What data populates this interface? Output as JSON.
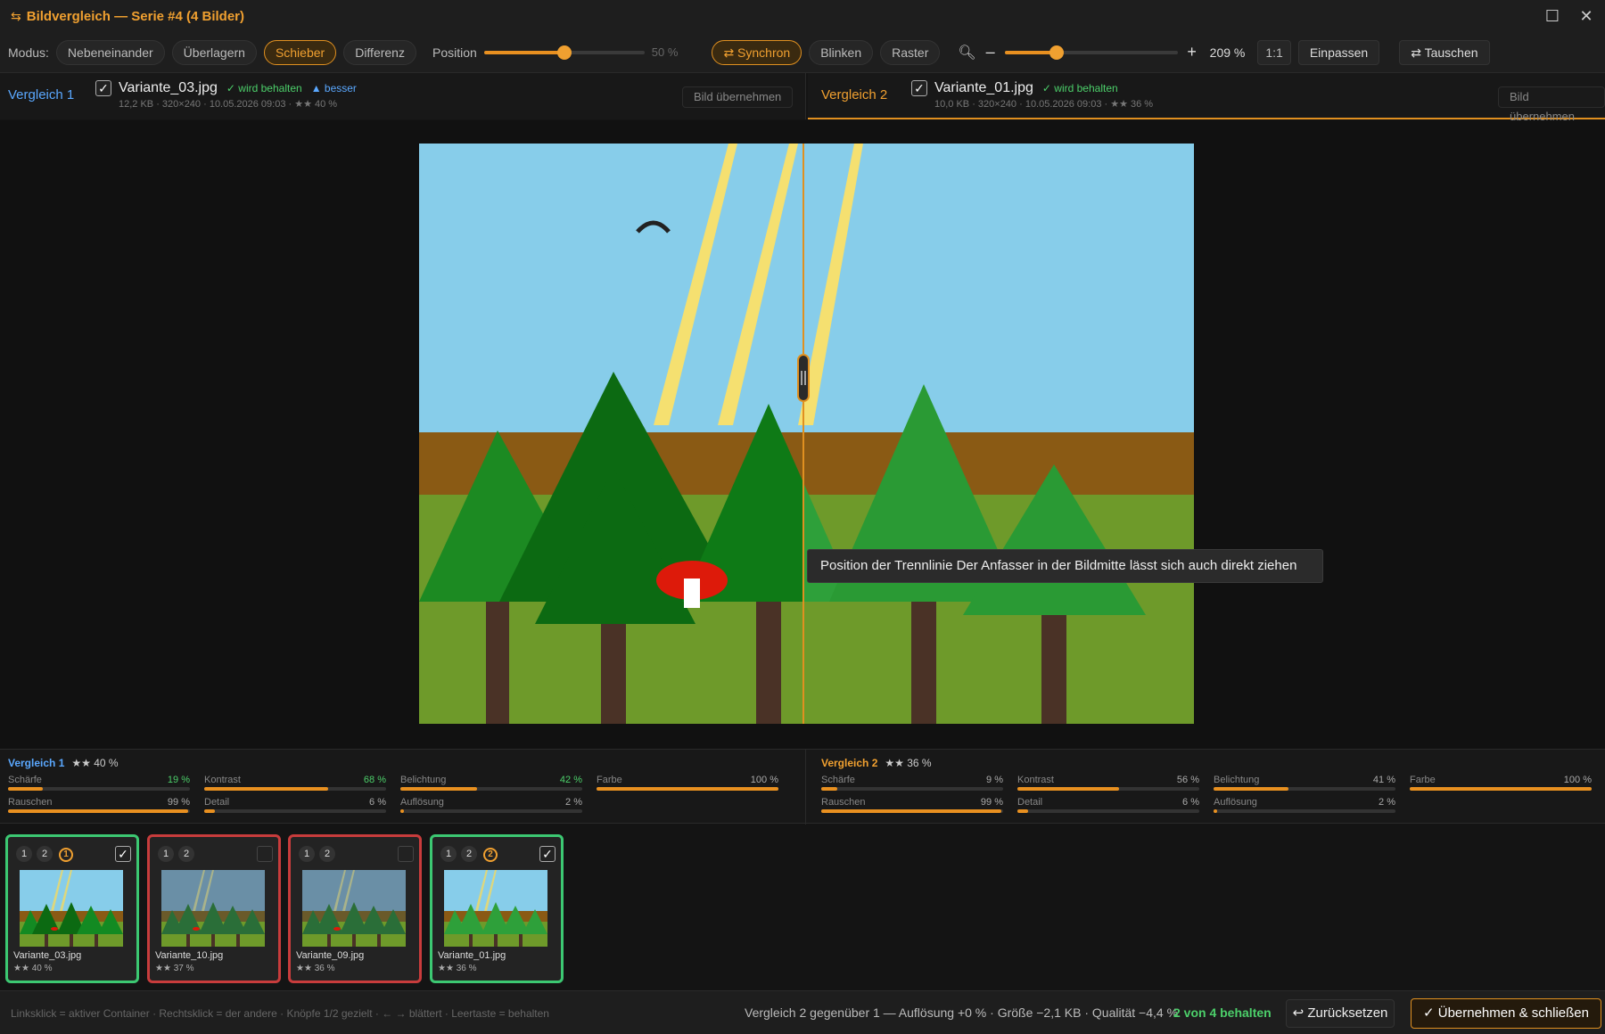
{
  "window": {
    "title": "Bildvergleich — Serie #4 (4 Bilder)"
  },
  "toolbar": {
    "mode_label": "Modus:",
    "modes": [
      "Nebeneinander",
      "Überlagern",
      "Schieber",
      "Differenz"
    ],
    "active_mode": "Schieber",
    "position_label": "Position",
    "position_value": "50 %",
    "position_fraction": 0.5,
    "sync_label": "⇄ Synchron",
    "blink_label": "Blinken",
    "grid_label": "Raster",
    "zoom_minus": "–",
    "zoom_plus": "+",
    "zoom_value": "209 %",
    "zoom_fraction": 0.3,
    "one_to_one": "1:1",
    "fit_label": "Einpassen",
    "swap_label": "⇄ Tauschen"
  },
  "compare1": {
    "tag": "Vergleich 1",
    "filename": "Variante_03.jpg",
    "keep_badge": "✓ wird behalten",
    "better_badge": "▲ besser",
    "meta": "12,2 KB · 320×240 · 10.05.2026 09:03 · ★★ 40 %",
    "take_label": "Bild übernehmen",
    "score": "★★ 40 %"
  },
  "compare2": {
    "tag": "Vergleich 2",
    "filename": "Variante_01.jpg",
    "keep_badge": "✓ wird behalten",
    "meta": "10,0 KB · 320×240 · 10.05.2026 09:03 · ★★ 36 %",
    "take_label": "Bild übernehmen",
    "score": "★★ 36 %"
  },
  "tooltip": "Position der Trennlinie Der Anfasser in der Bildmitte lässt sich auch direkt ziehen",
  "metrics1": [
    {
      "name": "Schärfe",
      "value": "19 %",
      "fraction": 0.19,
      "highlight": true
    },
    {
      "name": "Kontrast",
      "value": "68 %",
      "fraction": 0.68,
      "highlight": true
    },
    {
      "name": "Belichtung",
      "value": "42 %",
      "fraction": 0.42,
      "highlight": true
    },
    {
      "name": "Farbe",
      "value": "100 %",
      "fraction": 1.0,
      "highlight": false
    },
    {
      "name": "Rauschen",
      "value": "99 %",
      "fraction": 0.99,
      "highlight": false
    },
    {
      "name": "Detail",
      "value": "6 %",
      "fraction": 0.06,
      "highlight": false
    },
    {
      "name": "Auflösung",
      "value": "2 %",
      "fraction": 0.02,
      "highlight": false
    }
  ],
  "metrics2": [
    {
      "name": "Schärfe",
      "value": "9 %",
      "fraction": 0.09,
      "highlight": false
    },
    {
      "name": "Kontrast",
      "value": "56 %",
      "fraction": 0.56,
      "highlight": false
    },
    {
      "name": "Belichtung",
      "value": "41 %",
      "fraction": 0.41,
      "highlight": false
    },
    {
      "name": "Farbe",
      "value": "100 %",
      "fraction": 1.0,
      "highlight": false
    },
    {
      "name": "Rauschen",
      "value": "99 %",
      "fraction": 0.99,
      "highlight": false
    },
    {
      "name": "Detail",
      "value": "6 %",
      "fraction": 0.06,
      "highlight": false
    },
    {
      "name": "Auflösung",
      "value": "2 %",
      "fraction": 0.02,
      "highlight": false
    }
  ],
  "thumbnails": [
    {
      "name": "Variante_03.jpg",
      "stars": "★★ 40 %",
      "status": "keep",
      "checked": true,
      "badge": "1",
      "variant": "bright"
    },
    {
      "name": "Variante_10.jpg",
      "stars": "★★ 37 %",
      "status": "drop",
      "checked": false,
      "badge": "",
      "variant": "dim"
    },
    {
      "name": "Variante_09.jpg",
      "stars": "★★ 36 %",
      "status": "drop",
      "checked": false,
      "badge": "",
      "variant": "dim"
    },
    {
      "name": "Variante_01.jpg",
      "stars": "★★ 36 %",
      "status": "keep",
      "checked": true,
      "badge": "2",
      "variant": "light"
    }
  ],
  "thumb_buttons": [
    "1",
    "2"
  ],
  "statusbar": {
    "hint": "Linksklick = aktiver Container · Rechtsklick = der andere · Knöpfe 1/2 gezielt · ← → blättert · Leertaste = behalten",
    "summary": "Vergleich 2 gegenüber 1 — Auflösung +0 % · Größe −2,1 KB · Qualität −4,4 %",
    "kept": "2 von 4 behalten",
    "reset_label": "↩ Zurücksetzen",
    "apply_label": "✓ Übernehmen & schließen"
  },
  "colors": {
    "accent": "#f0a030",
    "keep": "#4ccf6a",
    "drop": "#c83c3c",
    "blue": "#5aa8ff"
  }
}
